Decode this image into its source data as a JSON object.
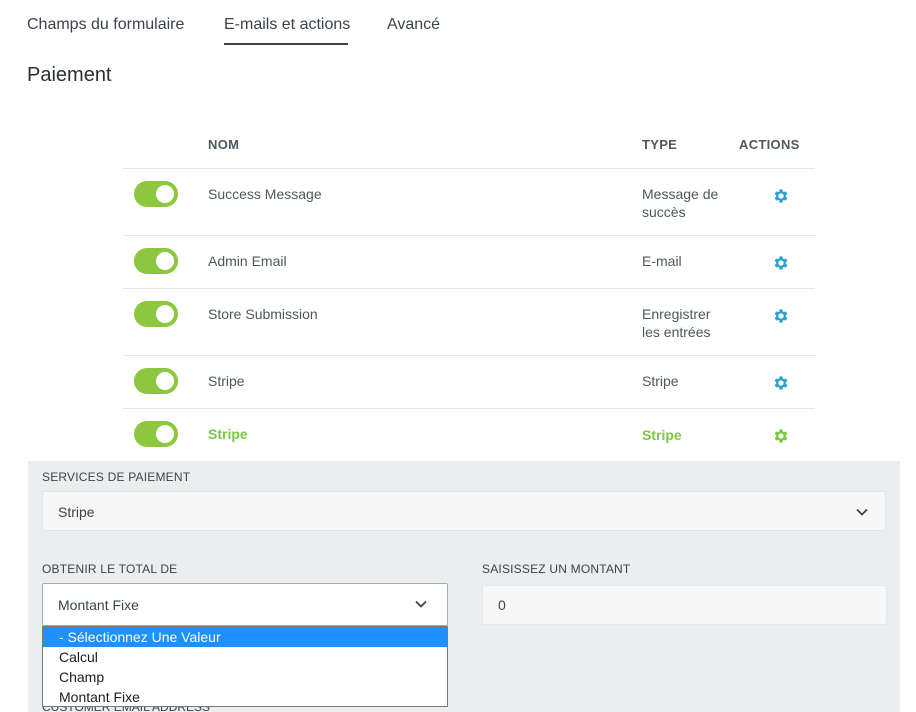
{
  "tabs": [
    {
      "label": "Champs du formulaire"
    },
    {
      "label": "E-mails et actions"
    },
    {
      "label": "Avancé"
    }
  ],
  "page_title": "Paiement",
  "table": {
    "headers": {
      "name": "NOM",
      "type": "TYPE",
      "actions": "ACTIONS"
    },
    "rows": [
      {
        "name": "Success Message",
        "type": "Message de succès",
        "enabled": true
      },
      {
        "name": "Admin Email",
        "type": "E-mail",
        "enabled": true
      },
      {
        "name": "Store Submission",
        "type": "Enregistrer les entrées",
        "enabled": true
      },
      {
        "name": "Stripe",
        "type": "Stripe",
        "enabled": true
      },
      {
        "name": "Stripe",
        "type": "Stripe",
        "enabled": true,
        "active": true
      }
    ]
  },
  "settings": {
    "payment_services_label": "SERVICES DE PAIEMENT",
    "payment_services_value": "Stripe",
    "total_from_label": "OBTENIR LE TOTAL DE",
    "total_from_value": "Montant Fixe",
    "amount_label": "SAISISSEZ UN MONTANT",
    "amount_value": "0",
    "dropdown_options": [
      "- Sélectionnez Une Valeur",
      "Calcul",
      "Champ",
      "Montant Fixe"
    ],
    "partially_hidden_label": "CUSTOMER EMAIL ADDRESS"
  },
  "colors": {
    "accent_green": "#8dc63f",
    "gear_blue": "#2ea2cc",
    "active_green": "#7ac943",
    "option_highlight": "#1e90ff"
  }
}
